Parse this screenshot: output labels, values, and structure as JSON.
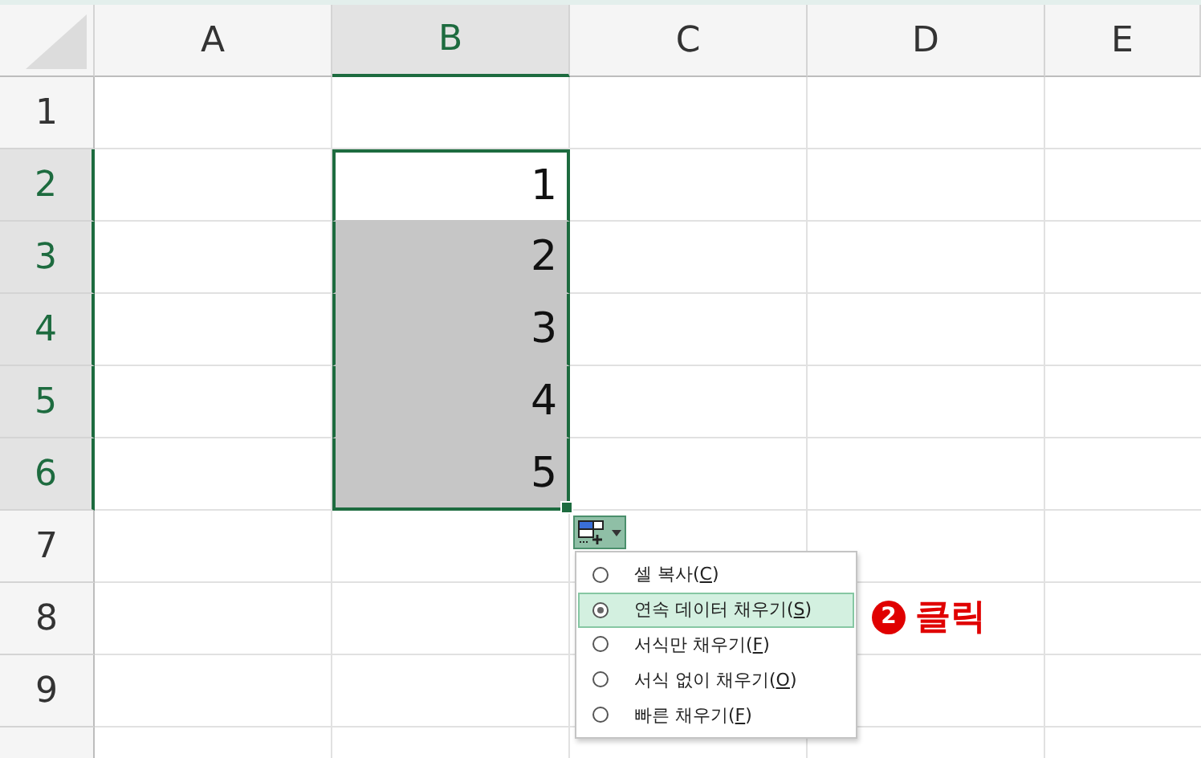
{
  "columns": [
    {
      "label": "A",
      "selected": false
    },
    {
      "label": "B",
      "selected": true
    },
    {
      "label": "C",
      "selected": false
    },
    {
      "label": "D",
      "selected": false
    },
    {
      "label": "E",
      "selected": false
    }
  ],
  "rows": [
    {
      "label": "1",
      "selected": false
    },
    {
      "label": "2",
      "selected": true,
      "cell": {
        "value": "1",
        "selected": true,
        "highlighted": false
      }
    },
    {
      "label": "3",
      "selected": true,
      "cell": {
        "value": "2",
        "selected": true,
        "highlighted": true
      }
    },
    {
      "label": "4",
      "selected": true,
      "cell": {
        "value": "3",
        "selected": true,
        "highlighted": true
      }
    },
    {
      "label": "5",
      "selected": true,
      "cell": {
        "value": "4",
        "selected": true,
        "highlighted": true
      }
    },
    {
      "label": "6",
      "selected": true,
      "cell": {
        "value": "5",
        "selected": true,
        "highlighted": true
      }
    },
    {
      "label": "7",
      "selected": false
    },
    {
      "label": "8",
      "selected": false
    },
    {
      "label": "9",
      "selected": false
    }
  ],
  "autofill_menu": {
    "items": [
      {
        "text_before": "셀 복사(",
        "access_key": "C",
        "text_after": ")",
        "selected": false
      },
      {
        "text_before": "연속 데이터 채우기(",
        "access_key": "S",
        "text_after": ")",
        "selected": true
      },
      {
        "text_before": "서식만 채우기(",
        "access_key": "F",
        "text_after": ")",
        "selected": false
      },
      {
        "text_before": "서식 없이 채우기(",
        "access_key": "O",
        "text_after": ")",
        "selected": false
      },
      {
        "text_before": "빠른 채우기(",
        "access_key": "F",
        "text_after": ")",
        "selected": false
      }
    ]
  },
  "annotation": {
    "step": "2",
    "text": "클릭"
  }
}
